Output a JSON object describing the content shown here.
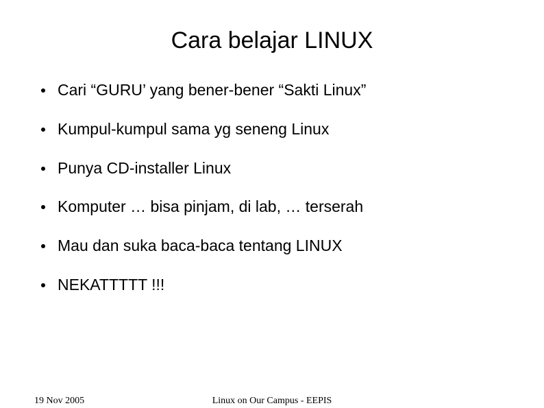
{
  "title": "Cara belajar LINUX",
  "bullets": [
    "Cari “GURU’ yang bener-bener “Sakti Linux”",
    "Kumpul-kumpul sama yg seneng Linux",
    "Punya CD-installer Linux",
    "Komputer … bisa pinjam, di lab, … terserah",
    "Mau dan suka baca-baca tentang LINUX",
    "NEKATTTTT !!!"
  ],
  "footer": {
    "left": "19 Nov 2005",
    "center": "Linux on Our Campus - EEPIS"
  }
}
